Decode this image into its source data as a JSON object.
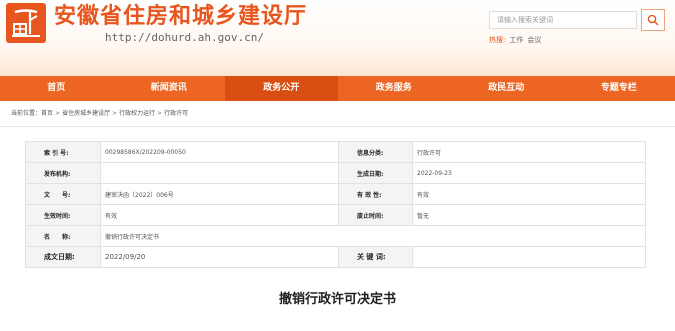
{
  "header": {
    "title": "安徽省住房和城乡建设厅",
    "url": "http://dohurd.ah.gov.cn/",
    "search_placeholder": "请输入搜索关键词",
    "hot_label": "热搜:",
    "hot_terms": [
      "工作",
      "会议"
    ]
  },
  "nav": {
    "items": [
      {
        "label": "首页"
      },
      {
        "label": "新闻资讯"
      },
      {
        "label": "政务公开"
      },
      {
        "label": "政务服务"
      },
      {
        "label": "政民互动"
      },
      {
        "label": "专题专栏"
      }
    ],
    "active_index": 2
  },
  "breadcrumb": {
    "prefix": "当前位置：",
    "items": [
      "首页",
      "省住房城乡建设厅",
      "行政权力运行",
      "行政许可"
    ],
    "separator": ">"
  },
  "meta": {
    "rows": [
      [
        {
          "label": "索 引 号:",
          "value": "00298586X/202209-00050"
        },
        {
          "label": "信息分类:",
          "value": "行政许可"
        }
      ],
      [
        {
          "label": "发布机构:",
          "value": ""
        },
        {
          "label": "生成日期:",
          "value": "2022-09-23"
        }
      ],
      [
        {
          "label": "文　　号:",
          "value": "建审决函〔2022〕006号"
        },
        {
          "label": "有 效 性:",
          "value": "有效"
        }
      ],
      [
        {
          "label": "生效时间:",
          "value": "有效"
        },
        {
          "label": "废止时间:",
          "value": "暂无"
        }
      ],
      [
        {
          "label": "名　　称:",
          "value": "撤销行政许可决定书"
        }
      ],
      [
        {
          "label": "成文日期:",
          "value": "2022/09/20"
        },
        {
          "label": "关 键 词:",
          "value": ""
        }
      ]
    ]
  },
  "document": {
    "title": "撤销行政许可决定书"
  },
  "colors": {
    "brand": "#e8561f",
    "nav_bg": "#ec6522",
    "nav_active": "#d94e12",
    "label_bg": "#f4f4f4",
    "border": "#e2e2e2"
  },
  "icons": {
    "logo": "ministry-emblem-icon",
    "search": "search-icon"
  }
}
